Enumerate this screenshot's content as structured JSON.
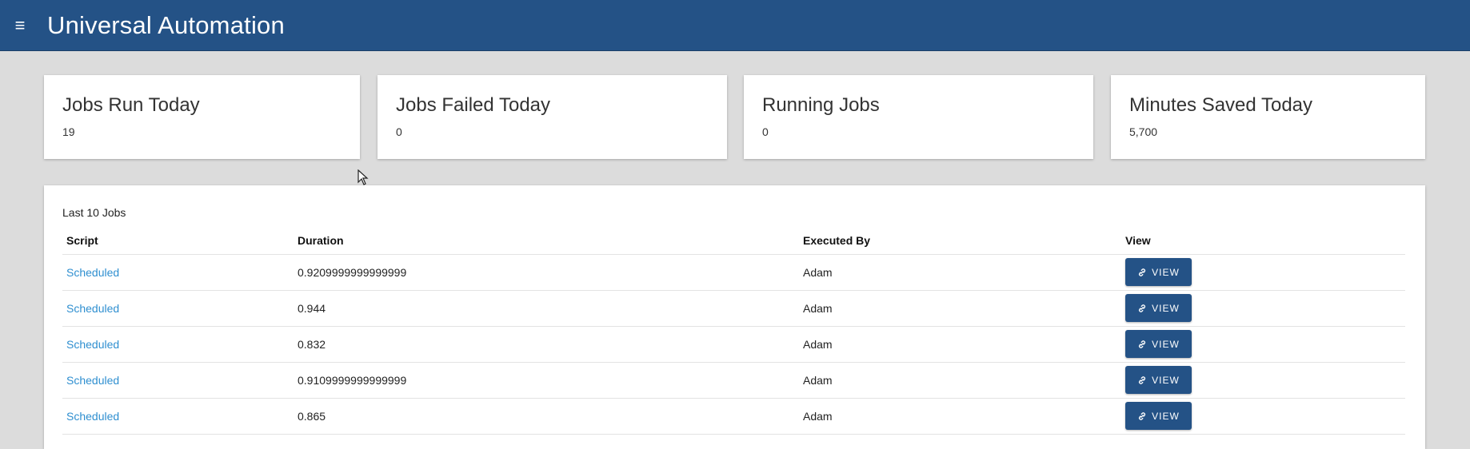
{
  "app": {
    "title": "Universal Automation",
    "menu_icon": "hamburger-menu-icon"
  },
  "cards": [
    {
      "title": "Jobs Run Today",
      "value": "19"
    },
    {
      "title": "Jobs Failed Today",
      "value": "0"
    },
    {
      "title": "Running Jobs",
      "value": "0"
    },
    {
      "title": "Minutes Saved Today",
      "value": "5,700"
    }
  ],
  "jobs": {
    "title": "Last 10 Jobs",
    "columns": [
      "Script",
      "Duration",
      "Executed By",
      "View"
    ],
    "rows": [
      {
        "script": "Scheduled",
        "duration": "0.9209999999999999",
        "executed_by": "Adam",
        "view": "VIEW"
      },
      {
        "script": "Scheduled",
        "duration": "0.944",
        "executed_by": "Adam",
        "view": "VIEW"
      },
      {
        "script": "Scheduled",
        "duration": "0.832",
        "executed_by": "Adam",
        "view": "VIEW"
      },
      {
        "script": "Scheduled",
        "duration": "0.9109999999999999",
        "executed_by": "Adam",
        "view": "VIEW"
      },
      {
        "script": "Scheduled",
        "duration": "0.865",
        "executed_by": "Adam",
        "view": "VIEW"
      }
    ]
  },
  "colors": {
    "appbar": "#245286",
    "link": "#2f8fd0",
    "background": "#dcdcdc"
  }
}
